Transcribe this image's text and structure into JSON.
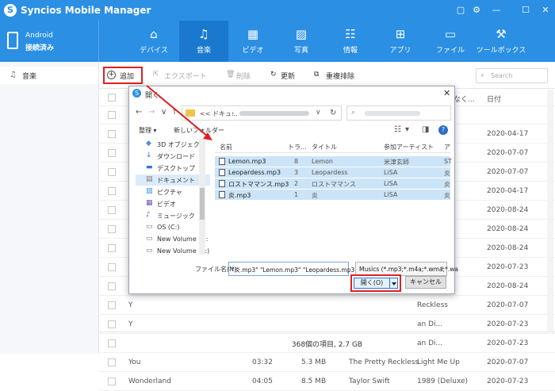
{
  "app": {
    "title": "Syncios Mobile Manager",
    "logo_letter": "S"
  },
  "window_controls": {
    "chat": "▢",
    "settings": "⚙",
    "minimize": "—",
    "maximize": "☐",
    "close": "✕"
  },
  "device": {
    "name": "Android",
    "status": "接続済み"
  },
  "nav_tabs": [
    {
      "label": "デバイス",
      "icon": "home-icon",
      "glyph": "⌂"
    },
    {
      "label": "音楽",
      "icon": "music-icon",
      "glyph": "♫"
    },
    {
      "label": "ビデオ",
      "icon": "video-icon",
      "glyph": "▦"
    },
    {
      "label": "写真",
      "icon": "photo-icon",
      "glyph": "▨"
    },
    {
      "label": "情報",
      "icon": "contacts-icon",
      "glyph": "☷"
    },
    {
      "label": "アプリ",
      "icon": "apps-icon",
      "glyph": "⊞"
    },
    {
      "label": "ファイル",
      "icon": "folder-icon",
      "glyph": "▭"
    },
    {
      "label": "ツールボックス",
      "icon": "toolbox-icon",
      "glyph": "⚒"
    }
  ],
  "sidebar": {
    "items": [
      {
        "label": "音楽",
        "icon": "music-note-icon",
        "glyph": "♫"
      }
    ]
  },
  "toolbar": {
    "add": "追加",
    "export": "エクスポート",
    "delete": "削除",
    "refresh": "更新",
    "dedupe": "重複排除",
    "search_placeholder": "Search"
  },
  "table": {
    "header_visible": {
      "artist_tail": "なく...",
      "date": "日付"
    },
    "rows": [
      {
        "num": "",
        "title": "",
        "duration": "",
        "size": "",
        "artist": "",
        "album": "",
        "date": ""
      },
      {
        "num": "2",
        "title": "",
        "duration": "",
        "size": "",
        "artist": "",
        "album": "",
        "date": "2020-04-17"
      },
      {
        "num": "2",
        "title": "",
        "duration": "",
        "size": "",
        "artist": "",
        "album": "Reckless",
        "date": "2020-07-07"
      },
      {
        "num": "S",
        "title": "",
        "duration": "",
        "size": "",
        "artist": "",
        "album": "",
        "date": "2020-07-07"
      },
      {
        "num": "",
        "title": "",
        "duration": "",
        "size": "",
        "artist": "",
        "album": "",
        "date": "2020-04-17"
      },
      {
        "num": "Y",
        "title": "",
        "duration": "",
        "size": "",
        "artist": "",
        "album": "",
        "date": "2020-08-24"
      },
      {
        "num": "Y",
        "title": "",
        "duration": "",
        "size": "",
        "artist": "",
        "album": "",
        "date": "2020-08-24"
      },
      {
        "num": "Y",
        "title": "",
        "duration": "",
        "size": "",
        "artist": "",
        "album": "an Di...",
        "date": "2020-08-24"
      },
      {
        "num": "Y",
        "title": "",
        "duration": "",
        "size": "",
        "artist": "",
        "album": "",
        "date": "2020-07-23"
      },
      {
        "num": "Y",
        "title": "",
        "duration": "",
        "size": "",
        "artist": "",
        "album": "an Di...",
        "date": "2020-08-24"
      },
      {
        "num": "Y",
        "title": "",
        "duration": "",
        "size": "",
        "artist": "",
        "album": "Reckless",
        "date": "2020-07-07"
      },
      {
        "num": "Y",
        "title": "",
        "duration": "",
        "size": "",
        "artist": "",
        "album": "an Di...",
        "date": "2020-07-23"
      },
      {
        "num": "",
        "title": "",
        "duration": "",
        "size": "",
        "artist": "",
        "album": "an Di...",
        "date": "2020-07-23"
      },
      {
        "num": "",
        "title": "You",
        "duration": "03:32",
        "size": "5.3 MB",
        "artist": "The Pretty Reckless",
        "album": "Light Me Up",
        "date": "2020-07-07"
      },
      {
        "num": "",
        "title": "Wonderland",
        "duration": "04:05",
        "size": "8.5 MB",
        "artist": "Taylor Swift",
        "album": "1989 (Deluxe)",
        "date": "2020-07-23"
      }
    ]
  },
  "footer": {
    "summary": "368個の項目, 2.7 GB"
  },
  "dialog": {
    "title": "開く",
    "close": "✕",
    "path_prefix": "<< ドキュ...",
    "path_sep": "›",
    "organize": "整理 ▾",
    "new_folder": "新しいフォルダー",
    "help": "?",
    "tree": [
      {
        "label": "3D オブジェクト",
        "icon": "3d-objects-icon",
        "glyph": "◆",
        "color": "#4a90d9"
      },
      {
        "label": "ダウンロード",
        "icon": "download-icon",
        "glyph": "↓",
        "color": "#2b78d6"
      },
      {
        "label": "デスクトップ",
        "icon": "desktop-icon",
        "glyph": "▬",
        "color": "#2b78d6"
      },
      {
        "label": "ドキュメント",
        "icon": "documents-icon",
        "glyph": "▤",
        "color": "#777777"
      },
      {
        "label": "ピクチャ",
        "icon": "pictures-icon",
        "glyph": "▨",
        "color": "#3a9ad9"
      },
      {
        "label": "ビデオ",
        "icon": "videos-icon",
        "glyph": "▦",
        "color": "#6b5bb5"
      },
      {
        "label": "ミュージック",
        "icon": "music-folder-icon",
        "glyph": "♪",
        "color": "#2b78d6"
      },
      {
        "label": "OS (C:)",
        "icon": "drive-icon",
        "glyph": "▭",
        "color": "#777777"
      },
      {
        "label": "New Volume (D:",
        "icon": "drive-icon",
        "glyph": "▭",
        "color": "#777777"
      },
      {
        "label": "New Volume (E:)",
        "icon": "drive-icon",
        "glyph": "▭",
        "color": "#777777"
      }
    ],
    "columns": [
      "名前",
      "トラ...",
      "タイトル",
      "参加アーティスト",
      "ア"
    ],
    "files": [
      {
        "name": "Lemon.mp3",
        "track": "8",
        "title": "Lemon",
        "artist": "米津玄師",
        "extra": "ST"
      },
      {
        "name": "Leopardess.mp3",
        "track": "3",
        "title": "Leopardess",
        "artist": "LiSA",
        "extra": "炎"
      },
      {
        "name": "ロストママンス.mp3",
        "track": "2",
        "title": "ロストママンス",
        "artist": "LiSA",
        "extra": "炎"
      },
      {
        "name": "炎.mp3",
        "track": "1",
        "title": "炎",
        "artist": "LiSA",
        "extra": "炎"
      }
    ],
    "filename_label": "ファイル名(N):",
    "filename_value": "\"炎.mp3\" \"Lemon.mp3\" \"Leopardess.mp3\"",
    "filetype_value": "Musics (*.mp3;*.m4a;*.wma;*.wa",
    "open_button": "開く(O)",
    "cancel_button": "キャンセル"
  },
  "colors": {
    "brand_blue": "#2b8fe3",
    "highlight_red": "#e02020",
    "selection": "#cce4f7"
  }
}
